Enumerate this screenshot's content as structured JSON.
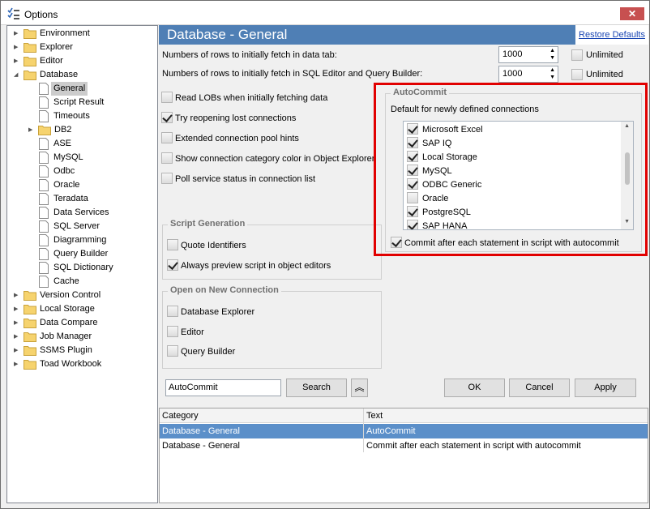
{
  "window": {
    "title": "Options",
    "close_glyph": "✕"
  },
  "tree": {
    "items": [
      {
        "label": "Environment",
        "icon": "folder-icon",
        "expander": "▶"
      },
      {
        "label": "Explorer",
        "icon": "folder-icon",
        "expander": "▶"
      },
      {
        "label": "Editor",
        "icon": "folder-icon",
        "expander": "▶"
      },
      {
        "label": "Database",
        "icon": "folder-icon",
        "expander": "◢"
      },
      {
        "label": "General",
        "icon": "page-icon",
        "selected": true
      },
      {
        "label": "Script Result",
        "icon": "page-icon"
      },
      {
        "label": "Timeouts",
        "icon": "page-icon"
      },
      {
        "label": "DB2",
        "icon": "folder-icon",
        "expander": "▶"
      },
      {
        "label": "ASE",
        "icon": "page-icon"
      },
      {
        "label": "MySQL",
        "icon": "page-icon"
      },
      {
        "label": "Odbc",
        "icon": "page-icon"
      },
      {
        "label": "Oracle",
        "icon": "page-icon"
      },
      {
        "label": "Teradata",
        "icon": "page-icon"
      },
      {
        "label": "Data Services",
        "icon": "page-icon"
      },
      {
        "label": "SQL Server",
        "icon": "page-icon"
      },
      {
        "label": "Diagramming",
        "icon": "page-icon"
      },
      {
        "label": "Query Builder",
        "icon": "page-icon"
      },
      {
        "label": "SQL Dictionary",
        "icon": "page-icon"
      },
      {
        "label": "Cache",
        "icon": "page-icon"
      },
      {
        "label": "Version Control",
        "icon": "folder-icon",
        "expander": "▶"
      },
      {
        "label": "Local Storage",
        "icon": "folder-icon",
        "expander": "▶"
      },
      {
        "label": "Data Compare",
        "icon": "folder-icon",
        "expander": "▶"
      },
      {
        "label": "Job Manager",
        "icon": "folder-icon",
        "expander": "▶"
      },
      {
        "label": "SSMS Plugin",
        "icon": "folder-icon",
        "expander": "▶"
      },
      {
        "label": "Toad Workbook",
        "icon": "folder-icon",
        "expander": "▶"
      }
    ]
  },
  "header": {
    "title": "Database - General",
    "restore_label": "Restore Defaults"
  },
  "fetch": {
    "data_tab_label": "Numbers of rows to initially fetch in data tab:",
    "data_tab_value": "1000",
    "editor_label": "Numbers of rows to initially fetch in SQL Editor and Query Builder:",
    "editor_value": "1000",
    "unlimited_label": "Unlimited",
    "unlimited1_checked": false,
    "unlimited2_checked": false
  },
  "options": [
    {
      "label": "Read LOBs when initially fetching data",
      "checked": false
    },
    {
      "label": "Try reopening lost connections",
      "checked": true
    },
    {
      "label": "Extended connection pool hints",
      "checked": false
    },
    {
      "label": "Show connection category color in Object Explorer",
      "checked": false
    },
    {
      "label": "Poll service status in connection list",
      "checked": false
    }
  ],
  "script_generation": {
    "title": "Script Generation",
    "items": [
      {
        "label": "Quote Identifiers",
        "checked": false
      },
      {
        "label": "Always preview script in object editors",
        "checked": true
      }
    ]
  },
  "open_on_new_connection": {
    "title": "Open on New Connection",
    "items": [
      {
        "label": "Database Explorer",
        "checked": false
      },
      {
        "label": "Editor",
        "checked": false
      },
      {
        "label": "Query Builder",
        "checked": false
      }
    ]
  },
  "autocommit": {
    "title": "AutoCommit",
    "default_label": "Default for newly defined connections",
    "connections": [
      {
        "label": "Microsoft Excel",
        "checked": true
      },
      {
        "label": "SAP IQ",
        "checked": true
      },
      {
        "label": "Local Storage",
        "checked": true
      },
      {
        "label": "MySQL",
        "checked": true
      },
      {
        "label": "ODBC Generic",
        "checked": true
      },
      {
        "label": "Oracle",
        "checked": false
      },
      {
        "label": "PostgreSQL",
        "checked": true
      },
      {
        "label": "SAP HANA",
        "checked": true
      }
    ],
    "commit_label": "Commit after each statement in script with autocommit",
    "commit_checked": true,
    "highlight_color": "#e10000"
  },
  "search": {
    "value": "AutoCommit",
    "button_label": "Search",
    "up_glyph": "︽"
  },
  "dialog_buttons": {
    "ok": "OK",
    "cancel": "Cancel",
    "apply": "Apply"
  },
  "results": {
    "columns": [
      "Category",
      "Text"
    ],
    "rows": [
      {
        "category": "Database - General",
        "text": "AutoCommit",
        "selected": true
      },
      {
        "category": "Database - General",
        "text": "Commit after each statement in script with autocommit",
        "selected": false
      }
    ]
  },
  "colors": {
    "header_bg": "#4f7fb5",
    "selection_bg": "#5b8fc9",
    "link": "#1a46b3"
  }
}
